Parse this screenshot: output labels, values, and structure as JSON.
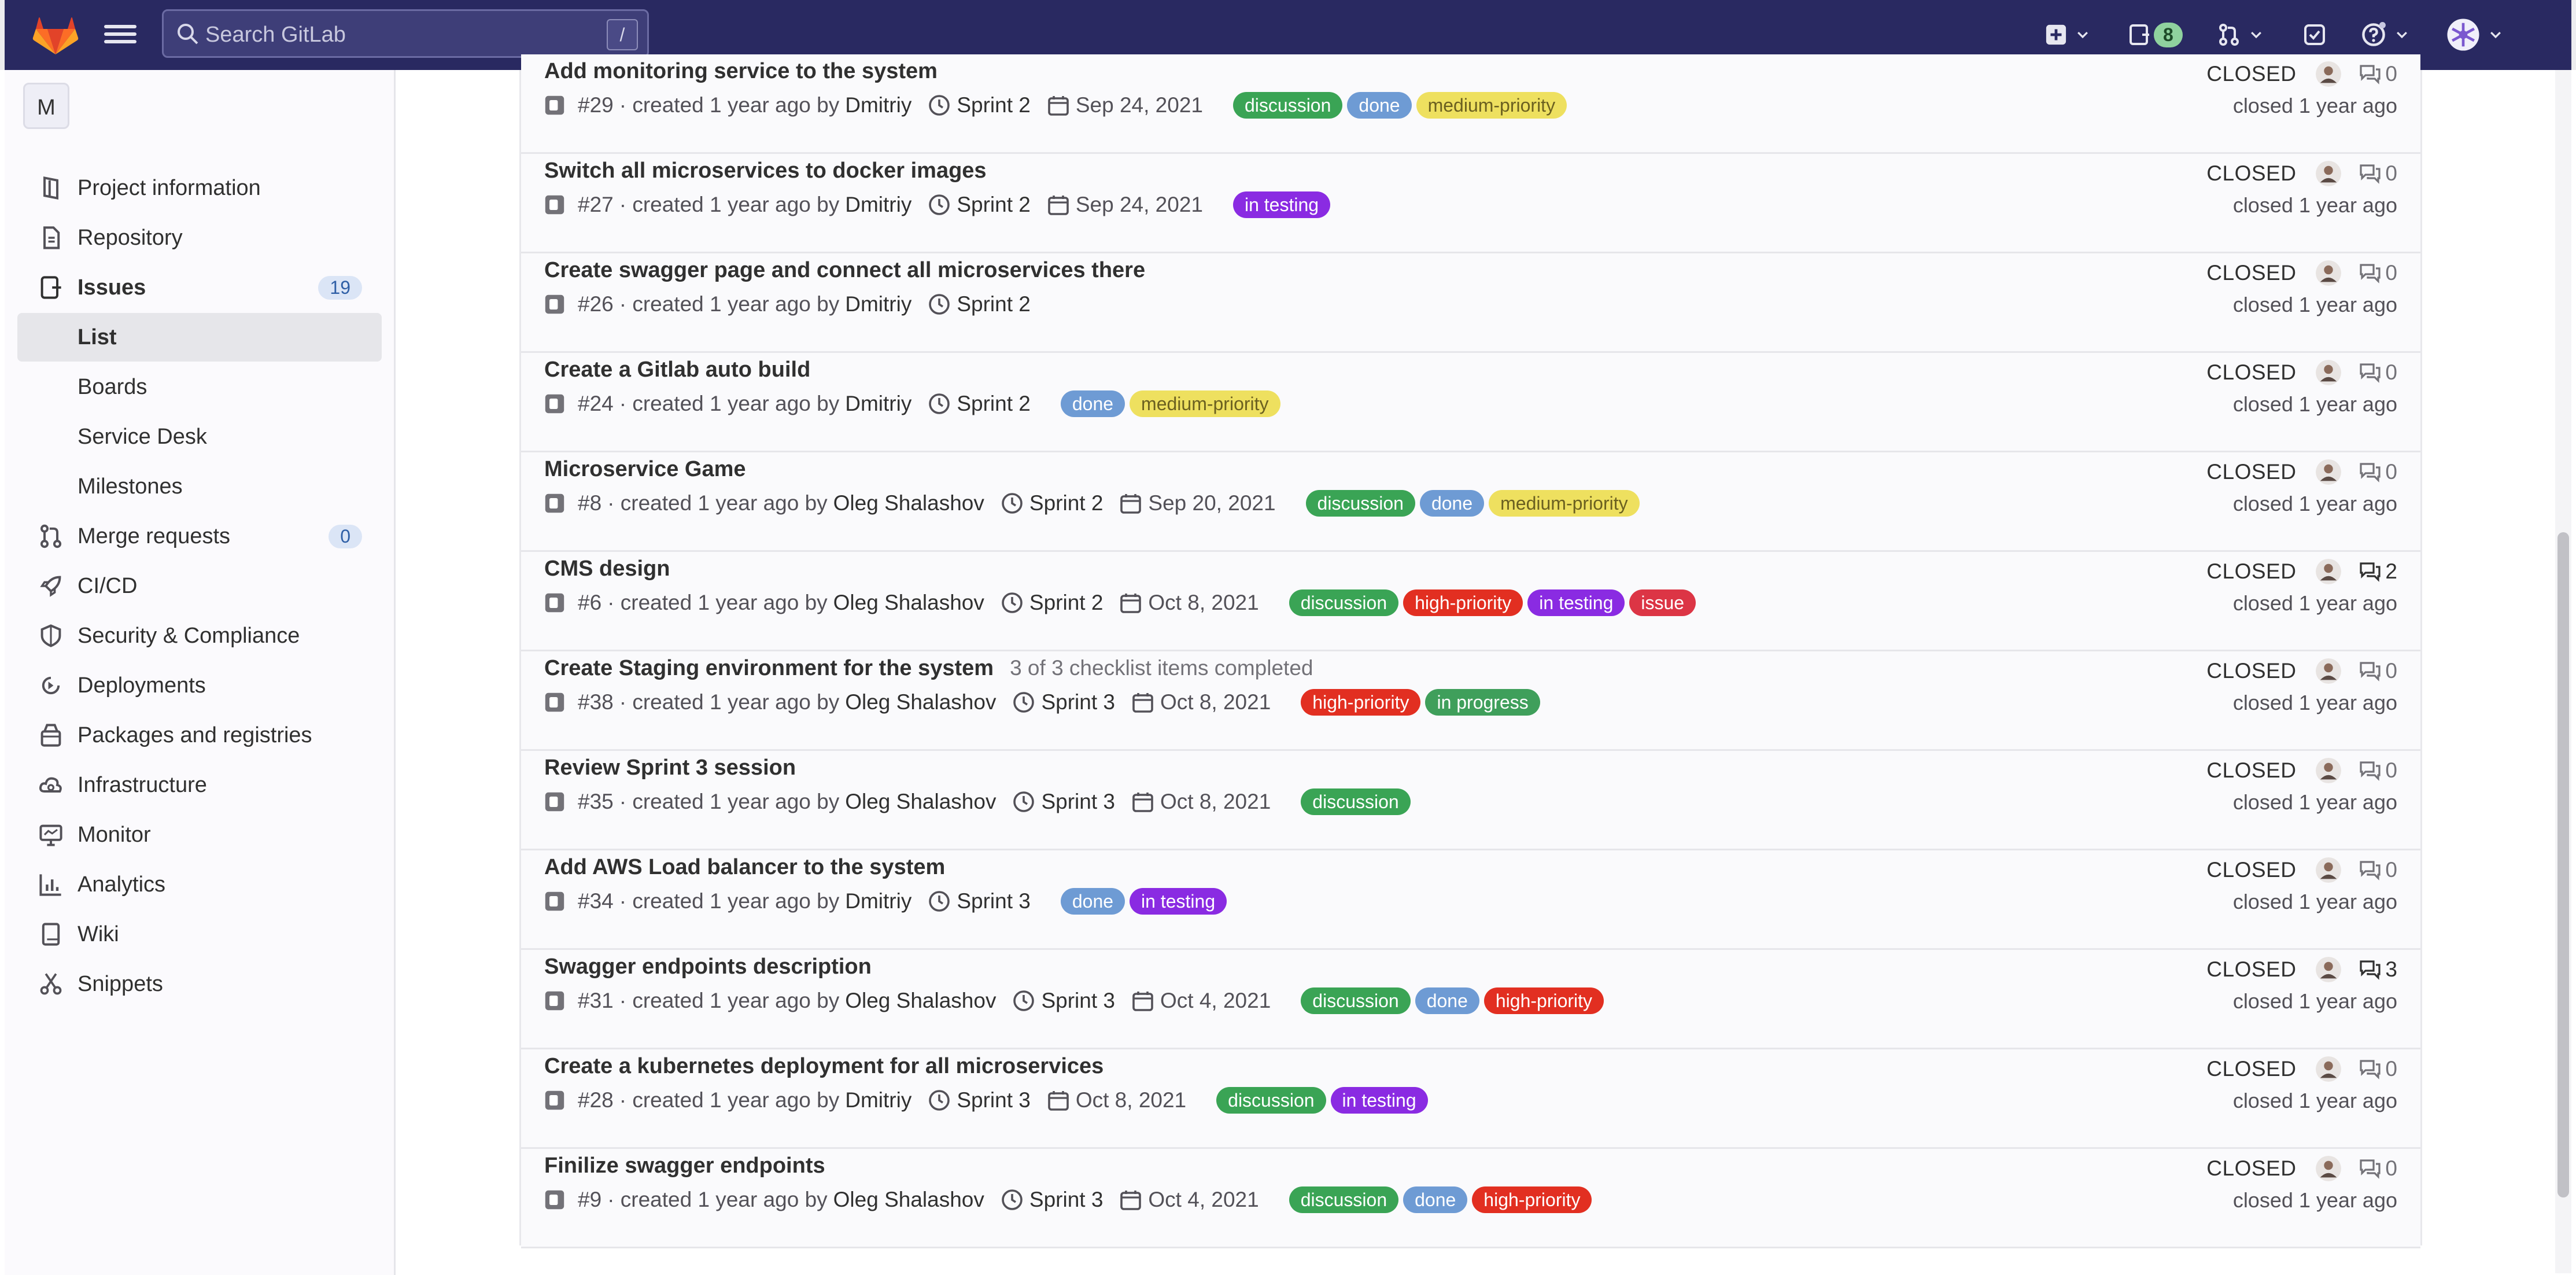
{
  "search": {
    "placeholder": "Search GitLab",
    "shortcut": "/"
  },
  "topnav": {
    "mr_count": "8"
  },
  "sidebar": {
    "project_initial": "M",
    "items": [
      {
        "label": "Project information",
        "icon": "project-info-icon"
      },
      {
        "label": "Repository",
        "icon": "repository-icon"
      },
      {
        "label": "Issues",
        "icon": "issues-icon",
        "badge": "19"
      },
      {
        "label": "List"
      },
      {
        "label": "Boards"
      },
      {
        "label": "Service Desk"
      },
      {
        "label": "Milestones"
      },
      {
        "label": "Merge requests",
        "icon": "merge-request-icon",
        "badge": "0"
      },
      {
        "label": "CI/CD",
        "icon": "rocket-icon"
      },
      {
        "label": "Security & Compliance",
        "icon": "shield-icon"
      },
      {
        "label": "Deployments",
        "icon": "deployments-icon"
      },
      {
        "label": "Packages and registries",
        "icon": "package-icon"
      },
      {
        "label": "Infrastructure",
        "icon": "cloud-icon"
      },
      {
        "label": "Monitor",
        "icon": "monitor-icon"
      },
      {
        "label": "Analytics",
        "icon": "chart-icon"
      },
      {
        "label": "Wiki",
        "icon": "book-icon"
      },
      {
        "label": "Snippets",
        "icon": "scissors-icon"
      }
    ]
  },
  "colors": {
    "discussion": "#3aa455",
    "done": "#6e9bd4",
    "medium-priority": "#eee05f",
    "in testing": "#8a2be2",
    "high-priority": "#e22f21",
    "in progress": "#3f9f5b",
    "issue": "#dc3545"
  },
  "issues": [
    {
      "title": "Add monitoring service to the system",
      "number": "#29",
      "created": "· created 1 year ago by",
      "author": "Dmitriy",
      "milestone": "Sprint 2",
      "due": "Sep 24, 2021",
      "labels": [
        "discussion",
        "done",
        "medium-priority"
      ],
      "status": "CLOSED",
      "comments": "0",
      "closed": "closed 1 year ago"
    },
    {
      "title": "Switch all microservices to docker images",
      "number": "#27",
      "created": "· created 1 year ago by",
      "author": "Dmitriy",
      "milestone": "Sprint 2",
      "due": "Sep 24, 2021",
      "labels": [
        "in testing"
      ],
      "status": "CLOSED",
      "comments": "0",
      "closed": "closed 1 year ago"
    },
    {
      "title": "Create swagger page and connect all microservices there",
      "number": "#26",
      "created": "· created 1 year ago by",
      "author": "Dmitriy",
      "milestone": "Sprint 2",
      "due": "",
      "labels": [],
      "status": "CLOSED",
      "comments": "0",
      "closed": "closed 1 year ago"
    },
    {
      "title": "Create a Gitlab auto build",
      "number": "#24",
      "created": "· created 1 year ago by",
      "author": "Dmitriy",
      "milestone": "Sprint 2",
      "due": "",
      "labels": [
        "done",
        "medium-priority"
      ],
      "status": "CLOSED",
      "comments": "0",
      "closed": "closed 1 year ago"
    },
    {
      "title": "Microservice Game",
      "number": "#8",
      "created": "· created 1 year ago by",
      "author": "Oleg Shalashov",
      "milestone": "Sprint 2",
      "due": "Sep 20, 2021",
      "labels": [
        "discussion",
        "done",
        "medium-priority"
      ],
      "status": "CLOSED",
      "comments": "0",
      "closed": "closed 1 year ago"
    },
    {
      "title": "CMS design",
      "number": "#6",
      "created": "· created 1 year ago by",
      "author": "Oleg Shalashov",
      "milestone": "Sprint 2",
      "due": "Oct 8, 2021",
      "labels": [
        "discussion",
        "high-priority",
        "in testing",
        "issue"
      ],
      "status": "CLOSED",
      "comments": "2",
      "closed": "closed 1 year ago"
    },
    {
      "title": "Create Staging environment for the system",
      "checklist": "3 of 3 checklist items completed",
      "number": "#38",
      "created": "· created 1 year ago by",
      "author": "Oleg Shalashov",
      "milestone": "Sprint 3",
      "due": "Oct 8, 2021",
      "labels": [
        "high-priority",
        "in progress"
      ],
      "status": "CLOSED",
      "comments": "0",
      "closed": "closed 1 year ago"
    },
    {
      "title": "Review Sprint 3 session",
      "number": "#35",
      "created": "· created 1 year ago by",
      "author": "Oleg Shalashov",
      "milestone": "Sprint 3",
      "due": "Oct 8, 2021",
      "labels": [
        "discussion"
      ],
      "status": "CLOSED",
      "comments": "0",
      "closed": "closed 1 year ago"
    },
    {
      "title": "Add AWS Load balancer to the system",
      "number": "#34",
      "created": "· created 1 year ago by",
      "author": "Dmitriy",
      "milestone": "Sprint 3",
      "due": "",
      "labels": [
        "done",
        "in testing"
      ],
      "status": "CLOSED",
      "comments": "0",
      "closed": "closed 1 year ago"
    },
    {
      "title": "Swagger endpoints description",
      "number": "#31",
      "created": "· created 1 year ago by",
      "author": "Oleg Shalashov",
      "milestone": "Sprint 3",
      "due": "Oct 4, 2021",
      "labels": [
        "discussion",
        "done",
        "high-priority"
      ],
      "status": "CLOSED",
      "comments": "3",
      "closed": "closed 1 year ago"
    },
    {
      "title": "Create a kubernetes deployment for all microservices",
      "number": "#28",
      "created": "· created 1 year ago by",
      "author": "Dmitriy",
      "milestone": "Sprint 3",
      "due": "Oct 8, 2021",
      "labels": [
        "discussion",
        "in testing"
      ],
      "status": "CLOSED",
      "comments": "0",
      "closed": "closed 1 year ago"
    },
    {
      "title": "Finilize swagger endpoints",
      "number": "#9",
      "created": "· created 1 year ago by",
      "author": "Oleg Shalashov",
      "milestone": "Sprint 3",
      "due": "Oct 4, 2021",
      "labels": [
        "discussion",
        "done",
        "high-priority"
      ],
      "status": "CLOSED",
      "comments": "0",
      "closed": "closed 1 year ago"
    }
  ]
}
